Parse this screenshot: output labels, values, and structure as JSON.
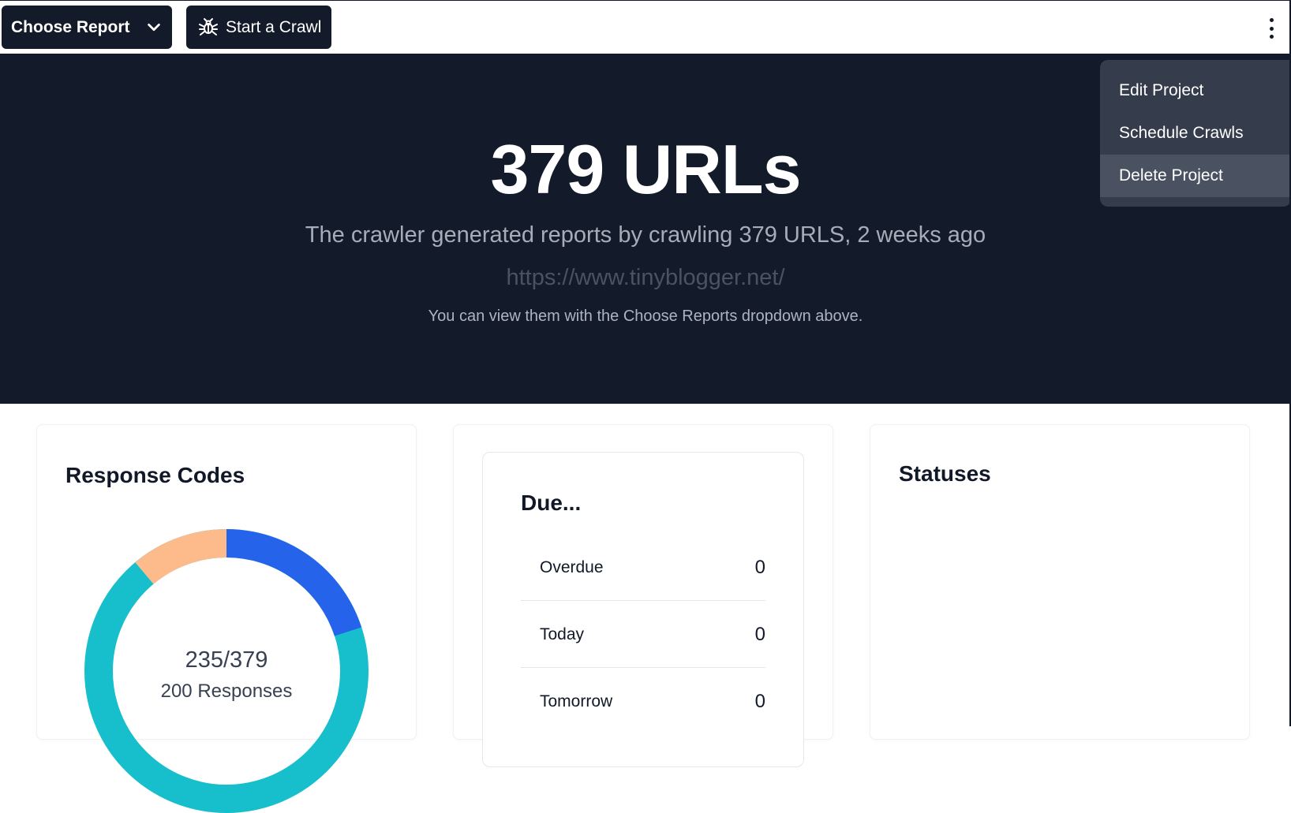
{
  "toolbar": {
    "choose_report_label": "Choose Report",
    "start_crawl_label": "Start a Crawl"
  },
  "menu": {
    "items": [
      {
        "label": "Edit Project"
      },
      {
        "label": "Schedule Crawls"
      },
      {
        "label": "Delete Project"
      }
    ],
    "highlighted_item": "Delete Project"
  },
  "hero": {
    "title": "379 URLs",
    "subtitle": "The crawler generated reports by crawling 379 URLS, 2 weeks ago",
    "url": "https://www.tinyblogger.net/",
    "note": "You can view them with the Choose Reports dropdown above."
  },
  "response_codes": {
    "title": "Response Codes",
    "center_value": "235/379",
    "center_label": "200 Responses"
  },
  "due": {
    "title": "Due...",
    "rows": [
      {
        "label": "Overdue",
        "value": "0"
      },
      {
        "label": "Today",
        "value": "0"
      },
      {
        "label": "Tomorrow",
        "value": "0"
      }
    ]
  },
  "statuses": {
    "title": "Statuses"
  },
  "colors": {
    "dark_bg": "#131a29",
    "menu_bg": "#353c4b",
    "donut_blue": "#2563eb",
    "donut_teal": "#17bfcc",
    "donut_peach": "#fdbb8c"
  }
}
